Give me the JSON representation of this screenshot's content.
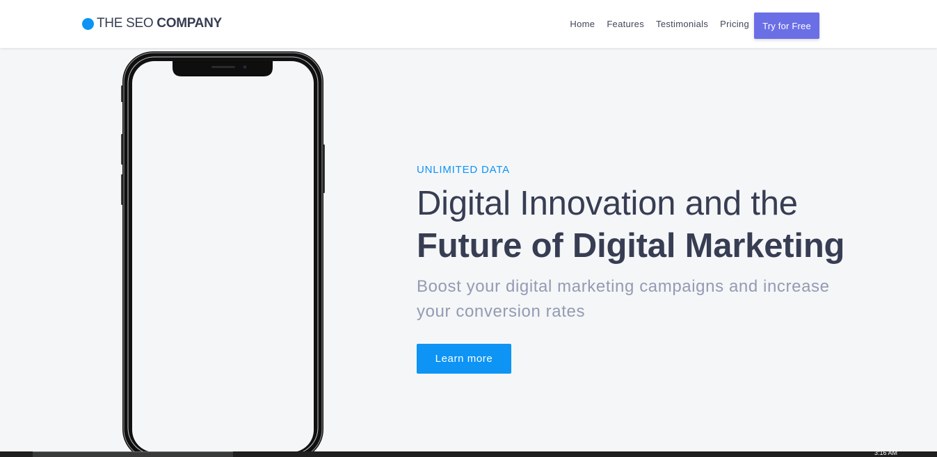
{
  "brand": {
    "name_light": "THE SEO ",
    "name_bold": "COMPANY",
    "dot_color": "#0d94f5"
  },
  "nav": {
    "items": [
      {
        "label": "Home"
      },
      {
        "label": "Features"
      },
      {
        "label": "Testimonials"
      },
      {
        "label": "Pricing"
      }
    ],
    "cta_label": "Try for Free",
    "cta_color": "#6b6fe6"
  },
  "hero": {
    "eyebrow": "UNLIMITED DATA",
    "headline_light": "Digital Innovation and the",
    "headline_bold": "Future of Digital Marketing",
    "subtext": "Boost your digital marketing campaigns and increase your conversion rates",
    "button_label": "Learn more",
    "accent_color": "#0d94f5"
  },
  "taskbar": {
    "clock": "3:16 AM"
  }
}
